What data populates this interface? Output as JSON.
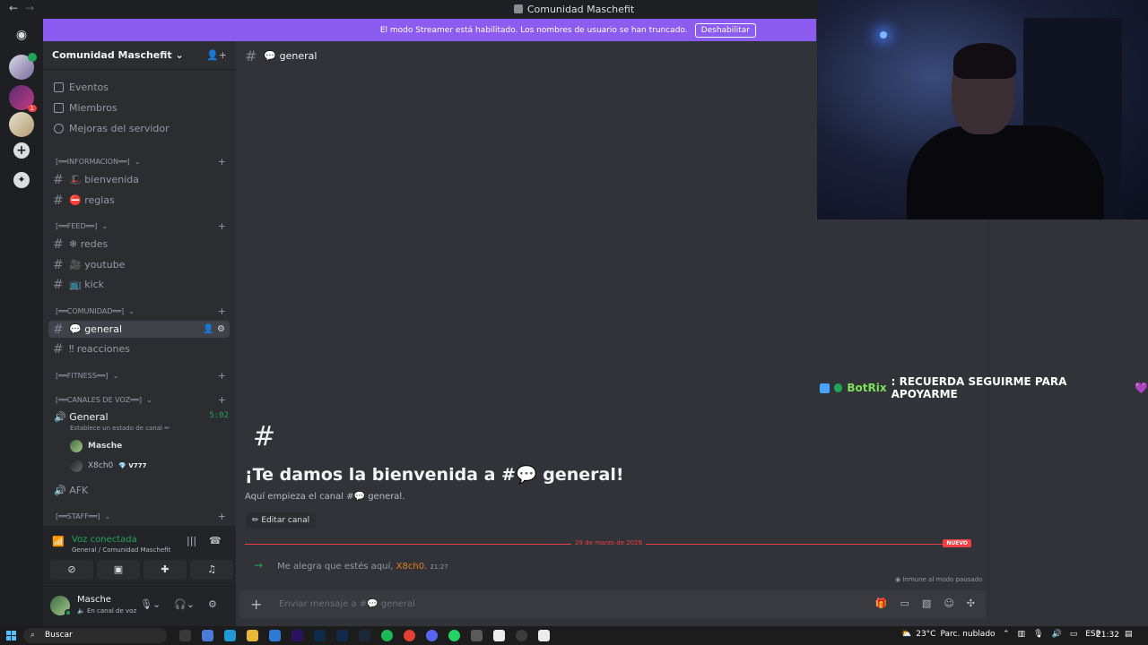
{
  "window": {
    "title": "Comunidad Maschefit"
  },
  "banner": {
    "text": "El modo Streamer está habilitado. Los nombres de usuario se han truncado.",
    "button": "Deshabilitar"
  },
  "server": {
    "name": "Comunidad Maschefit"
  },
  "nav": {
    "events": "Eventos",
    "members": "Miembros",
    "boosts": "Mejoras del servidor"
  },
  "categories": {
    "info": "[══INFORMACION══]",
    "feed": "[══FEED══]",
    "community": "[══COMUNIDAD══]",
    "fitness": "[══FITNESS══]",
    "voice": "[══CANALES DE VOZ══]",
    "staff": "[══STAFF══]"
  },
  "channels": {
    "bienvenida": "🎩 bienvenida",
    "reglas": "⛔ reglas",
    "redes": "❄ redes",
    "youtube": "🎥 youtube",
    "kick": "📺 kick",
    "general": "💬 general",
    "reacciones": "‼ reacciones"
  },
  "voice_channel": {
    "name": "General",
    "timer": "5:02",
    "status": "Establece un estado de canal ✏"
  },
  "voice_users": [
    {
      "name": "Masche",
      "tag": ""
    },
    {
      "name": "X8ch0",
      "tag": "💎 V777"
    }
  ],
  "afk": "AFK",
  "voice_panel": {
    "status": "Voz conectada",
    "sub": "General / Comunidad Maschefit"
  },
  "user": {
    "name": "Masche",
    "status": "🔈 En canal de voz"
  },
  "chat": {
    "header": "💬 general",
    "welcome_title": "¡Te damos la bienvenida a #💬 general!",
    "welcome_sub": "Aquí empieza el canal #💬 general.",
    "edit_button": "✏ Editar canal",
    "divider_date": "29 de marzo de 2026",
    "divider_new": "NUEVO",
    "message_text": "Me alegra que estés aquí,",
    "message_user": "X8ch0.",
    "message_time": "21:27",
    "immune": "◉ Inmune al modo pausado",
    "composer_placeholder": "Enviar mensaje a #💬 general"
  },
  "overlay": {
    "bot": "BotRix",
    "text": ": RECUERDA SEGUIRME PARA APOYARME",
    "heart": "💜"
  },
  "taskbar": {
    "search": "Buscar",
    "temp": "23°C",
    "weather": "Parc. nublado",
    "lang": "ESP",
    "time": "21:32"
  }
}
